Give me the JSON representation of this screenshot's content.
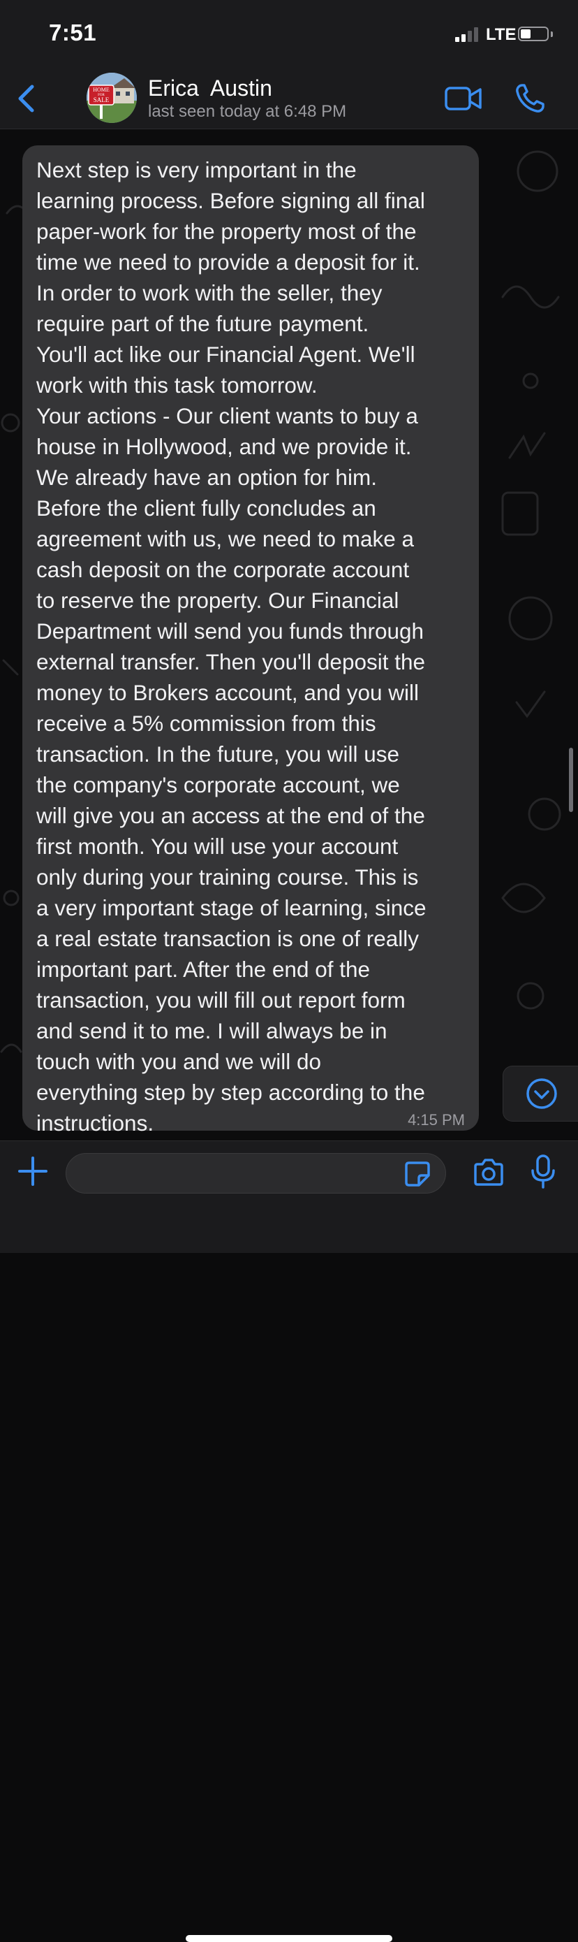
{
  "status_bar": {
    "time": "7:51",
    "network": "LTE"
  },
  "header": {
    "back_icon": "chevron-left-icon",
    "contact_name": "Erica  Austin",
    "last_seen": "last seen today at 6:48 PM",
    "avatar_sign_text": "HOME FOR SALE",
    "video_icon": "video-camera-icon",
    "call_icon": "phone-icon",
    "accent_color": "#3b8ef0"
  },
  "chat": {
    "message": {
      "text": "Next step is very important in the\nlearning process. Before signing all final\npaper-work for the property most of the\ntime we need to provide a deposit for it.\nIn order to work with the seller, they\nrequire part of the future payment.\nYou'll act like our Financial Agent. We'll\nwork with this task tomorrow.\nYour actions - Our client wants to buy a\nhouse in Hollywood, and we provide it.\nWe already have an option for him.\nBefore the client fully concludes an\nagreement with us, we need to make a\ncash deposit on the corporate account\nto reserve the property. Our Financial\nDepartment will send you funds through\nexternal transfer. Then you'll deposit the\nmoney to Brokers account, and you will\nreceive a 5% commission from this\ntransaction. In the future, you will use\nthe company's corporate account, we\nwill give you an access at the end of the\nfirst month. You will use your account\nonly during your training course. This is\na very important stage of learning, since\na real estate transaction is one of really\nimportant part. After the end of the\ntransaction, you will fill out report form\nand send it to me. I will always be in\ntouch with you and we will do\neverything step by step according to the\ninstructions.",
      "time": "4:15 PM",
      "bubble_color": "#353537"
    },
    "scroll_down_icon": "chevron-down-circle-icon"
  },
  "input_bar": {
    "attach_icon": "plus-icon",
    "message_value": "",
    "sticker_icon": "sticker-icon",
    "camera_icon": "camera-icon",
    "mic_icon": "microphone-icon"
  }
}
